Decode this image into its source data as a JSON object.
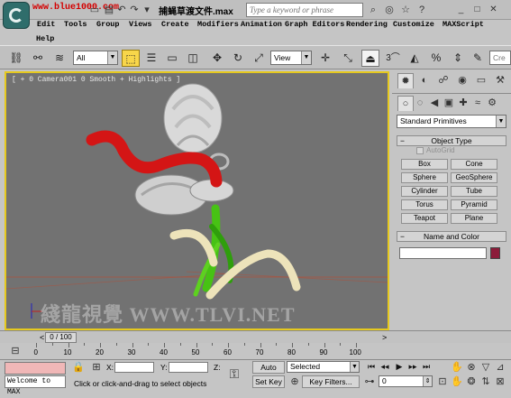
{
  "titlebar": {
    "watermark_url": "www.blue1000.com",
    "doc_title": "捕蝇草渡文件.max",
    "search_placeholder": "Type a keyword or phrase",
    "icons": [
      "new-icon",
      "open-icon",
      "save-icon",
      "undo-icon",
      "redo-icon",
      "dropdown-icon"
    ]
  },
  "menus": [
    "Edit",
    "Tools",
    "Group",
    "Views",
    "Create",
    "Modifiers",
    "Animation",
    "Graph Editors",
    "Rendering",
    "Customize",
    "MAXScript"
  ],
  "menu_help": "Help",
  "toolbar": {
    "selection_filter": "All",
    "reference_coord": "View",
    "count_badge": "3",
    "named_selection_placeholder": "Cre"
  },
  "viewport": {
    "label": "[ + 0 Camera001 0 Smooth + Highlights ]",
    "watermark": "綫龍視覺 WWW.TLVI.NET"
  },
  "command_panel": {
    "category": "Standard Primitives",
    "object_type_title": "Object Type",
    "autogrid_label": "AutoGrid",
    "object_buttons": [
      "Box",
      "Cone",
      "Sphere",
      "GeoSphere",
      "Cylinder",
      "Tube",
      "Torus",
      "Pyramid",
      "Teapot",
      "Plane"
    ],
    "name_color_title": "Name and Color",
    "object_color": "#8c1c3a"
  },
  "timeline": {
    "frame_display": "0 / 100",
    "tick_labels": [
      "0",
      "10",
      "20",
      "30",
      "40",
      "50",
      "60",
      "70",
      "80",
      "90",
      "100"
    ]
  },
  "statusbar": {
    "maxscript_text": "Welcome to MAX",
    "x_label": "X:",
    "y_label": "Y:",
    "z_label": "Z:",
    "prompt": "Click or click-and-drag to select objects",
    "auto_key": "Auto Key",
    "set_key": "Set Key",
    "key_mode": "Selected",
    "key_filters": "Key Filters...",
    "frame_value": "0"
  }
}
